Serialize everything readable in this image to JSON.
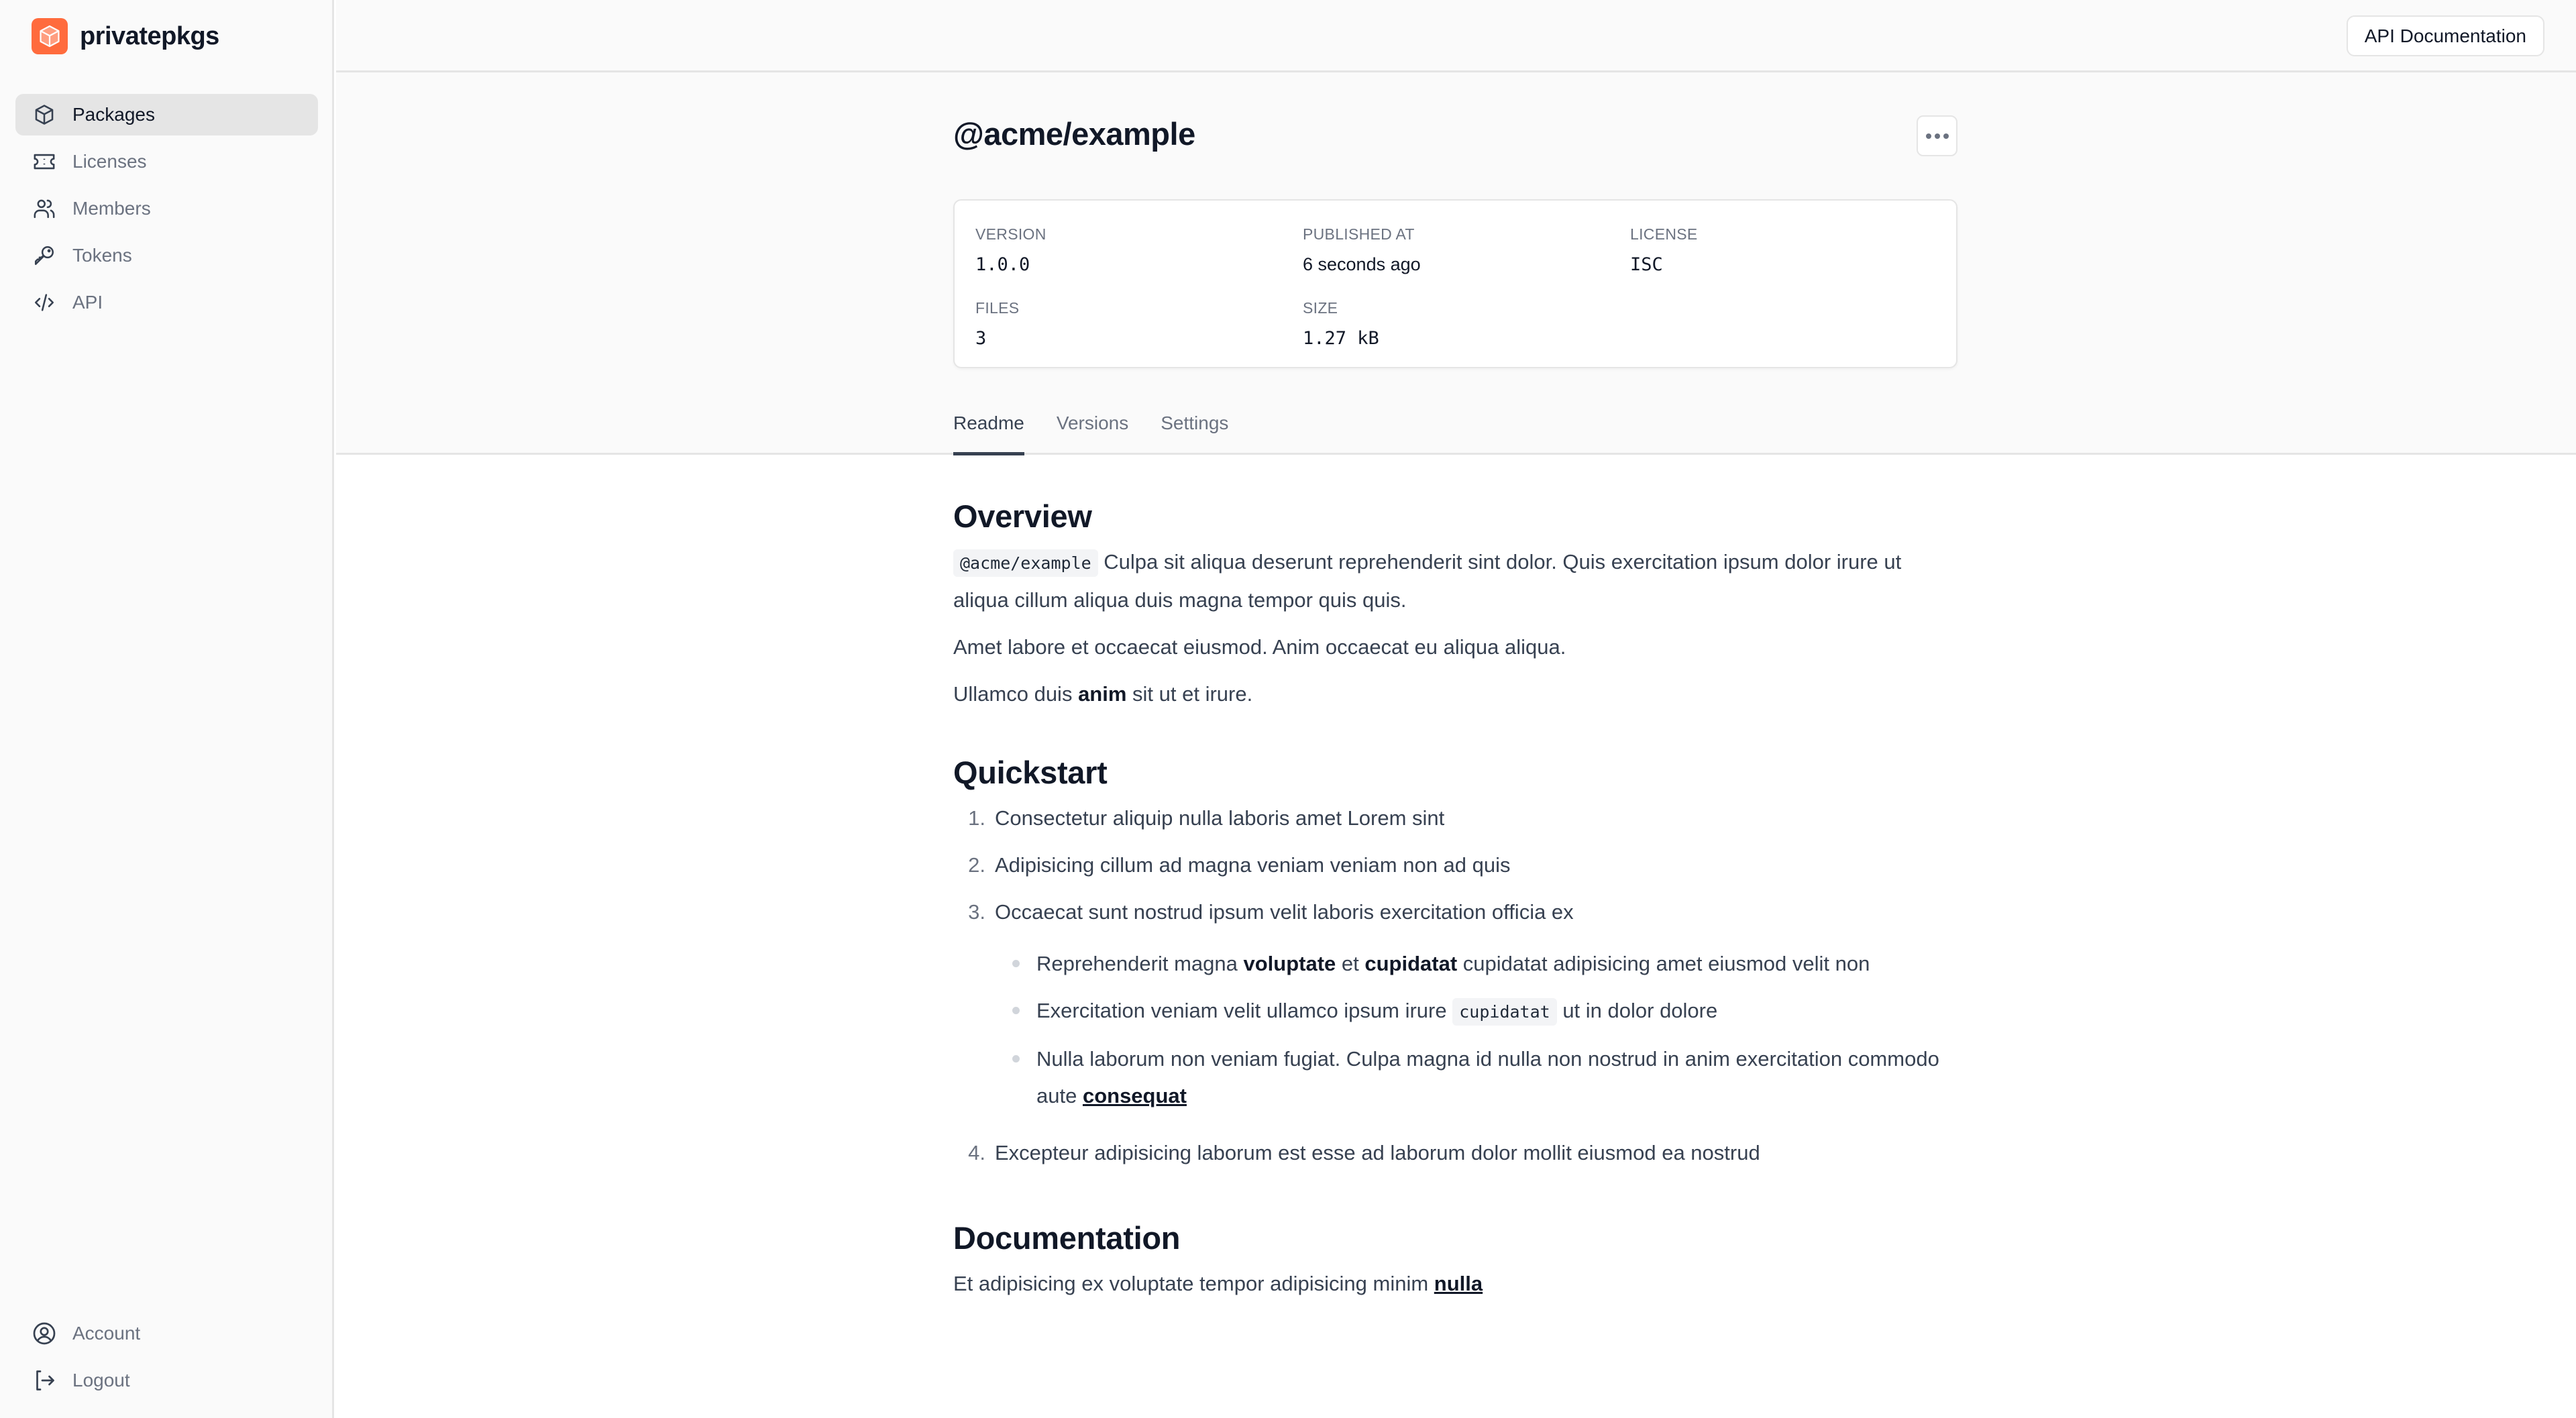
{
  "brand": {
    "name": "privatepkgs",
    "logo_color": "#ff6b3d"
  },
  "sidebar": {
    "items": [
      {
        "label": "Packages",
        "icon": "package-icon",
        "active": true
      },
      {
        "label": "Licenses",
        "icon": "ticket-icon",
        "active": false
      },
      {
        "label": "Members",
        "icon": "users-icon",
        "active": false
      },
      {
        "label": "Tokens",
        "icon": "key-icon",
        "active": false
      },
      {
        "label": "API",
        "icon": "code-icon",
        "active": false
      }
    ],
    "bottom_items": [
      {
        "label": "Account",
        "icon": "user-circle-icon"
      },
      {
        "label": "Logout",
        "icon": "logout-icon"
      }
    ]
  },
  "header": {
    "api_doc_label": "API Documentation"
  },
  "package": {
    "name": "@acme/example",
    "more_icon": "ellipsis-icon",
    "info": {
      "version": {
        "label": "Version",
        "value": "1.0.0"
      },
      "published_at": {
        "label": "Published at",
        "value": "6 seconds ago"
      },
      "license": {
        "label": "License",
        "value": "ISC"
      },
      "files": {
        "label": "Files",
        "value": "3"
      },
      "size": {
        "label": "Size",
        "value": "1.27 kB"
      }
    }
  },
  "tabs": [
    {
      "label": "Readme",
      "active": true
    },
    {
      "label": "Versions",
      "active": false
    },
    {
      "label": "Settings",
      "active": false
    }
  ],
  "readme": {
    "overview": {
      "title": "Overview",
      "p1_code": "@acme/example",
      "p1_text": " Culpa sit aliqua deserunt reprehenderit sint dolor. Quis exercitation ipsum dolor irure ut aliqua cillum aliqua duis magna tempor quis quis.",
      "p2": "Amet labore et occaecat eiusmod. Anim occaecat eu aliqua aliqua.",
      "p3_pre": "Ullamco duis ",
      "p3_bold": "anim",
      "p3_post": " sit ut et irure."
    },
    "quickstart": {
      "title": "Quickstart",
      "steps": [
        "Consectetur aliquip nulla laboris amet Lorem sint",
        "Adipisicing cillum ad magna veniam veniam non ad quis",
        "Occaecat sunt nostrud ipsum velit laboris exercitation officia ex",
        "Excepteur adipisicing laborum est esse ad laborum dolor mollit eiusmod ea nostrud"
      ],
      "sub_items": {
        "b1_pre": "Reprehenderit magna ",
        "b1_bold1": "voluptate",
        "b1_mid": " et ",
        "b1_bold2": "cupidatat",
        "b1_post": " cupidatat adipisicing amet eiusmod velit non",
        "b2_pre": "Exercitation veniam velit ullamco ipsum irure ",
        "b2_code": "cupidatat",
        "b2_post": " ut in dolor dolore",
        "b3_pre": "Nulla laborum non veniam fugiat. Culpa magna id nulla non nostrud in anim exercitation commodo aute ",
        "b3_link": "consequat"
      }
    },
    "documentation": {
      "title": "Documentation",
      "p_pre": "Et adipisicing ex voluptate tempor adipisicing minim ",
      "p_link": "nulla"
    }
  }
}
